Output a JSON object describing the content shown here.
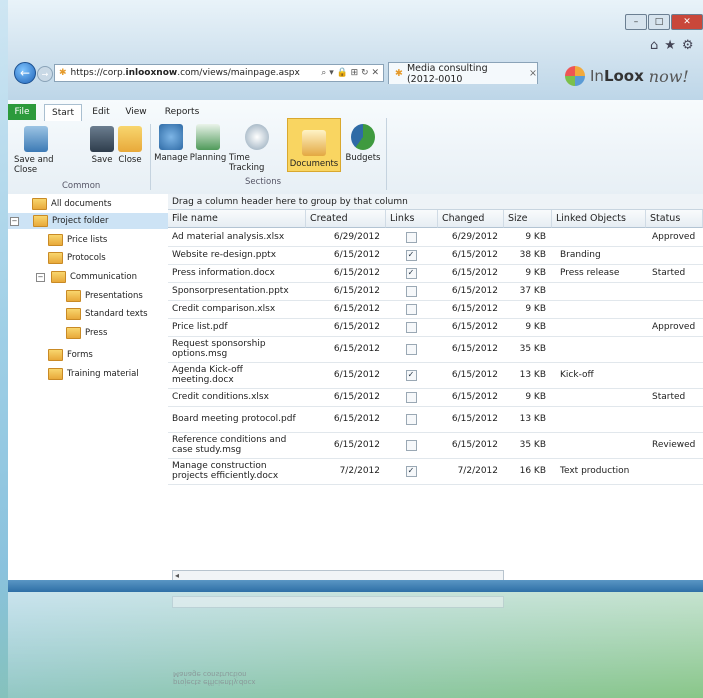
{
  "browser": {
    "url_host": "https://corp.",
    "url_bold": "inlooxnow",
    "url_rest": ".com/views/mainpage.aspx",
    "tab_title": "Media consulting (2012-0010",
    "tab_close": "×",
    "addr_controls": "⌕ ▾ 🔒 ⊞ ↻ ✕",
    "back_glyph": "←",
    "forward_glyph": "→",
    "minimize": "–",
    "maximize": "□",
    "close": "✕",
    "home_glyph": "⌂",
    "star_glyph": "★",
    "gear_glyph": "⚙"
  },
  "logo": {
    "brand_light": "In",
    "brand_bold": "Loox",
    "brand_script": "now!"
  },
  "ribbon": {
    "tabs": [
      "File",
      "Start",
      "Edit",
      "View",
      "Reports"
    ],
    "common": {
      "buttons": [
        "Save and Close",
        "Save",
        "Close"
      ],
      "label": "Common"
    },
    "sections": {
      "buttons": [
        "Manage",
        "Planning",
        "Time Tracking",
        "Documents",
        "Budgets"
      ],
      "label": "Sections"
    }
  },
  "tree": {
    "expand_minus": "−",
    "items": [
      {
        "label": "All documents"
      },
      {
        "label": "Project folder"
      },
      {
        "label": "Price lists"
      },
      {
        "label": "Protocols"
      },
      {
        "label": "Communication"
      },
      {
        "label": "Presentations"
      },
      {
        "label": "Standard texts"
      },
      {
        "label": "Press"
      },
      {
        "label": "Forms"
      },
      {
        "label": "Training material"
      }
    ]
  },
  "grid": {
    "group_hint": "Drag a column header here to group by that column",
    "columns": [
      "File name",
      "Created",
      "Links",
      "Changed",
      "Size",
      "Linked Objects",
      "Status"
    ],
    "rows": [
      {
        "name": "Ad material analysis.xlsx",
        "created": "6/29/2012",
        "linked": false,
        "changed": "6/29/2012",
        "size": "9 KB",
        "objects": "",
        "status": "Approved"
      },
      {
        "name": "Website re-design.pptx",
        "created": "6/15/2012",
        "linked": true,
        "changed": "6/15/2012",
        "size": "38 KB",
        "objects": "Branding",
        "status": ""
      },
      {
        "name": "Press information.docx",
        "created": "6/15/2012",
        "linked": true,
        "changed": "6/15/2012",
        "size": "9 KB",
        "objects": "Press release",
        "status": "Started"
      },
      {
        "name": "Sponsorpresentation.pptx",
        "created": "6/15/2012",
        "linked": false,
        "changed": "6/15/2012",
        "size": "37 KB",
        "objects": "",
        "status": ""
      },
      {
        "name": "Credit comparison.xlsx",
        "created": "6/15/2012",
        "linked": false,
        "changed": "6/15/2012",
        "size": "9 KB",
        "objects": "",
        "status": ""
      },
      {
        "name": "Price list.pdf",
        "created": "6/15/2012",
        "linked": false,
        "changed": "6/15/2012",
        "size": "9 KB",
        "objects": "",
        "status": "Approved"
      },
      {
        "name": "Request sponsorship options.msg",
        "created": "6/15/2012",
        "linked": false,
        "changed": "6/15/2012",
        "size": "35 KB",
        "objects": "",
        "status": ""
      },
      {
        "name": "Agenda Kick-off meeting.docx",
        "created": "6/15/2012",
        "linked": true,
        "changed": "6/15/2012",
        "size": "13 KB",
        "objects": "Kick-off",
        "status": ""
      },
      {
        "name": "Credit conditions.xlsx",
        "created": "6/15/2012",
        "linked": false,
        "changed": "6/15/2012",
        "size": "9 KB",
        "objects": "",
        "status": "Started"
      },
      {
        "name": "Board meeting protocol.pdf",
        "created": "6/15/2012",
        "linked": false,
        "changed": "6/15/2012",
        "size": "13 KB",
        "objects": "",
        "status": ""
      },
      {
        "name": "Reference conditions and case study.msg",
        "created": "6/15/2012",
        "linked": false,
        "changed": "6/15/2012",
        "size": "35 KB",
        "objects": "",
        "status": "Reviewed"
      },
      {
        "name": "Manage construction projects efficiently.docx",
        "created": "7/2/2012",
        "linked": true,
        "changed": "7/2/2012",
        "size": "16 KB",
        "objects": "Text production",
        "status": ""
      }
    ],
    "scroll_left": "◂"
  },
  "reflection": {
    "line1": "projects efficiently.docx",
    "line2": "Manage construction"
  },
  "colors": {
    "ribbon_bg": "#e7eff5",
    "selected_tree": "#cde3f5",
    "documents_button": "#f9d561",
    "file_tab": "#2c9a3c",
    "accent_blue": "#1f63b8"
  }
}
